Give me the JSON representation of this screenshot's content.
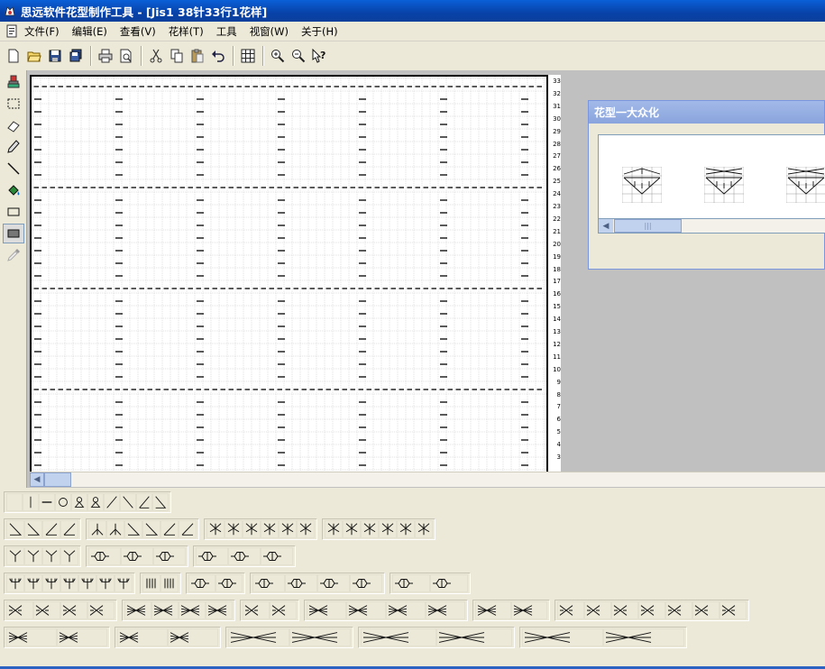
{
  "window": {
    "title": "思远软件花型制作工具 - [Jis1 38针33行1花样]"
  },
  "menu": {
    "items": [
      "文件(F)",
      "编辑(E)",
      "查看(V)",
      "花样(T)",
      "工具",
      "视窗(W)",
      "关于(H)"
    ]
  },
  "toolbar": {
    "buttons": [
      "new-icon",
      "open-icon",
      "save-icon",
      "save-all-icon",
      "print-icon",
      "print-preview-icon",
      "cut-icon",
      "copy-icon",
      "paste-icon",
      "undo-icon",
      "grid-icon",
      "zoom-in-icon",
      "zoom-out-icon",
      "help-icon"
    ]
  },
  "left_tools": {
    "buttons": [
      "stamp-icon",
      "select-rect-icon",
      "eraser-icon",
      "pencil-icon",
      "line-icon",
      "fill-icon",
      "rectangle-icon",
      "filled-rect-icon",
      "eyedropper-icon"
    ]
  },
  "canvas": {
    "stitches": 38,
    "rows": 33,
    "row_numbers": [
      "33",
      "32",
      "31",
      "30",
      "29",
      "28",
      "27",
      "26",
      "25",
      "24",
      "23",
      "22",
      "21",
      "20",
      "19",
      "18",
      "17",
      "16",
      "15",
      "14",
      "13",
      "12",
      "11",
      "10",
      "9",
      "8",
      "7",
      "6",
      "5",
      "4",
      "3"
    ]
  },
  "float_window": {
    "title": "花型一大众化",
    "scroll_thumb": "|||"
  },
  "colors": {
    "titlebar": "#0842a8",
    "float_titlebar": "#8aa5dd",
    "workspace": "#c0c0c0",
    "chrome": "#ece9d8"
  }
}
